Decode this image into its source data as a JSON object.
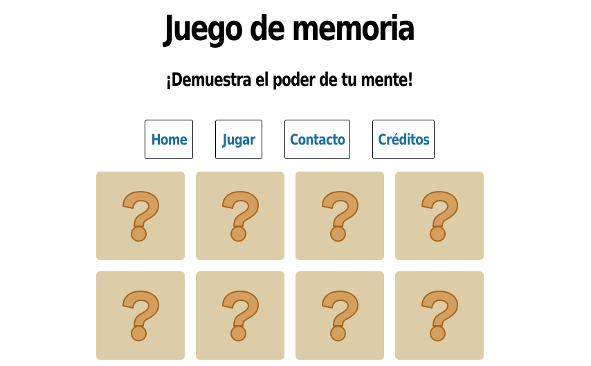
{
  "header": {
    "title": "Juego de memoria",
    "subtitle": "¡Demuestra el poder de tu mente!"
  },
  "nav": {
    "items": [
      {
        "label": "Home"
      },
      {
        "label": "Jugar"
      },
      {
        "label": "Contacto"
      },
      {
        "label": "Créditos"
      }
    ]
  },
  "board": {
    "cards": [
      {
        "state": "face-down",
        "icon": "question-mark-icon"
      },
      {
        "state": "face-down",
        "icon": "question-mark-icon"
      },
      {
        "state": "face-down",
        "icon": "question-mark-icon"
      },
      {
        "state": "face-down",
        "icon": "question-mark-icon"
      },
      {
        "state": "face-down",
        "icon": "question-mark-icon"
      },
      {
        "state": "face-down",
        "icon": "question-mark-icon"
      },
      {
        "state": "face-down",
        "icon": "question-mark-icon"
      },
      {
        "state": "face-down",
        "icon": "question-mark-icon"
      }
    ]
  },
  "colors": {
    "card_back": "#dccda8",
    "question_fill": "#d49f5f",
    "question_stroke": "#a8661d",
    "nav_link": "#1c6ea1"
  }
}
